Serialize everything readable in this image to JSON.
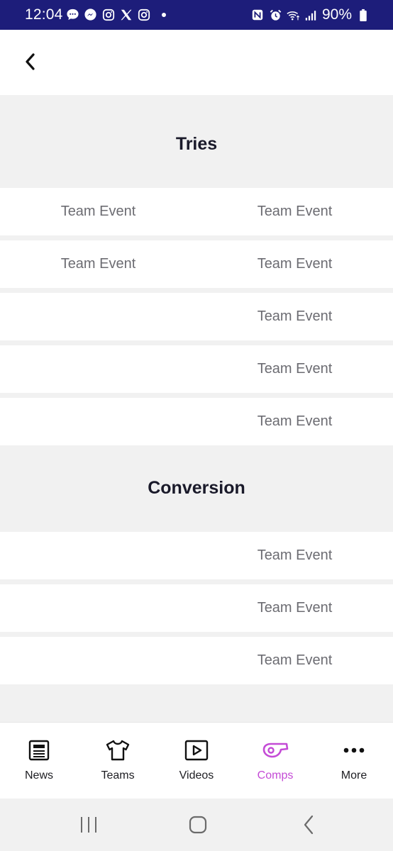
{
  "status_bar": {
    "time": "12:04",
    "battery": "90%",
    "left_icons": [
      "chat-bubble-icon",
      "messenger-icon",
      "instagram-icon",
      "x-logo-icon",
      "instagram-icon"
    ],
    "right_icons": [
      "nfc-icon",
      "alarm-icon",
      "wifi-icon",
      "signal-icon",
      "battery-icon"
    ],
    "background": "#1d1d7a"
  },
  "header": {
    "back_icon": "chevron-left-icon"
  },
  "sections": [
    {
      "title": "Tries",
      "rows": [
        {
          "left": "Team Event",
          "right": "Team Event"
        },
        {
          "left": "Team Event",
          "right": "Team Event"
        },
        {
          "left": "",
          "right": "Team Event"
        },
        {
          "left": "",
          "right": "Team Event"
        },
        {
          "left": "",
          "right": "Team Event"
        }
      ]
    },
    {
      "title": "Conversion",
      "rows": [
        {
          "left": "",
          "right": "Team Event"
        },
        {
          "left": "",
          "right": "Team Event"
        },
        {
          "left": "",
          "right": "Team Event"
        }
      ]
    }
  ],
  "bottom_nav": {
    "items": [
      {
        "label": "News",
        "icon": "newspaper-icon",
        "active": false
      },
      {
        "label": "Teams",
        "icon": "jersey-icon",
        "active": false
      },
      {
        "label": "Videos",
        "icon": "play-icon",
        "active": false
      },
      {
        "label": "Comps",
        "icon": "whistle-icon",
        "active": true
      },
      {
        "label": "More",
        "icon": "more-dots-icon",
        "active": false
      }
    ],
    "active_color": "#c44bd6"
  },
  "system_nav": {
    "recents_icon": "recents-icon",
    "home_icon": "home-icon",
    "back_icon": "back-icon"
  }
}
